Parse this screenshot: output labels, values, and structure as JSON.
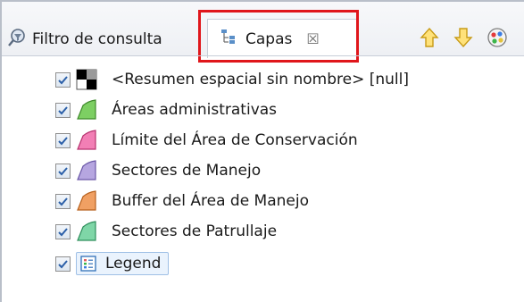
{
  "tabs": {
    "query_filter": {
      "label": "Filtro de consulta",
      "icon": "filter-icon"
    },
    "layers": {
      "label": "Capas",
      "icon": "layers-icon",
      "close_glyph": "☒"
    }
  },
  "toolbar": [
    {
      "name": "move-up-icon",
      "glyph": "⇧"
    },
    {
      "name": "move-down-icon",
      "glyph": "⇩"
    },
    {
      "name": "color-palette-icon",
      "glyph": "●"
    }
  ],
  "layers": [
    {
      "label": "<Resumen espacial sin nombre> [null]",
      "checked": true,
      "symbol": "grid",
      "color": "#000000"
    },
    {
      "label": "Áreas administrativas",
      "checked": true,
      "symbol": "polygon",
      "color": "#7dcf63"
    },
    {
      "label": "Límite del Área de Conservación",
      "checked": true,
      "symbol": "polygon",
      "color": "#f27fb5"
    },
    {
      "label": "Sectores de Manejo",
      "checked": true,
      "symbol": "polygon",
      "color": "#b6a6e0"
    },
    {
      "label": "Buffer del Área de Manejo",
      "checked": true,
      "symbol": "polygon",
      "color": "#f0a063"
    },
    {
      "label": "Sectores de Patrullaje",
      "checked": true,
      "symbol": "polygon",
      "color": "#7fd6a7"
    },
    {
      "label": "Legend",
      "checked": true,
      "symbol": "legend",
      "color": "#2f6fb7",
      "selected": true
    }
  ],
  "highlight_color": "#e0161b"
}
